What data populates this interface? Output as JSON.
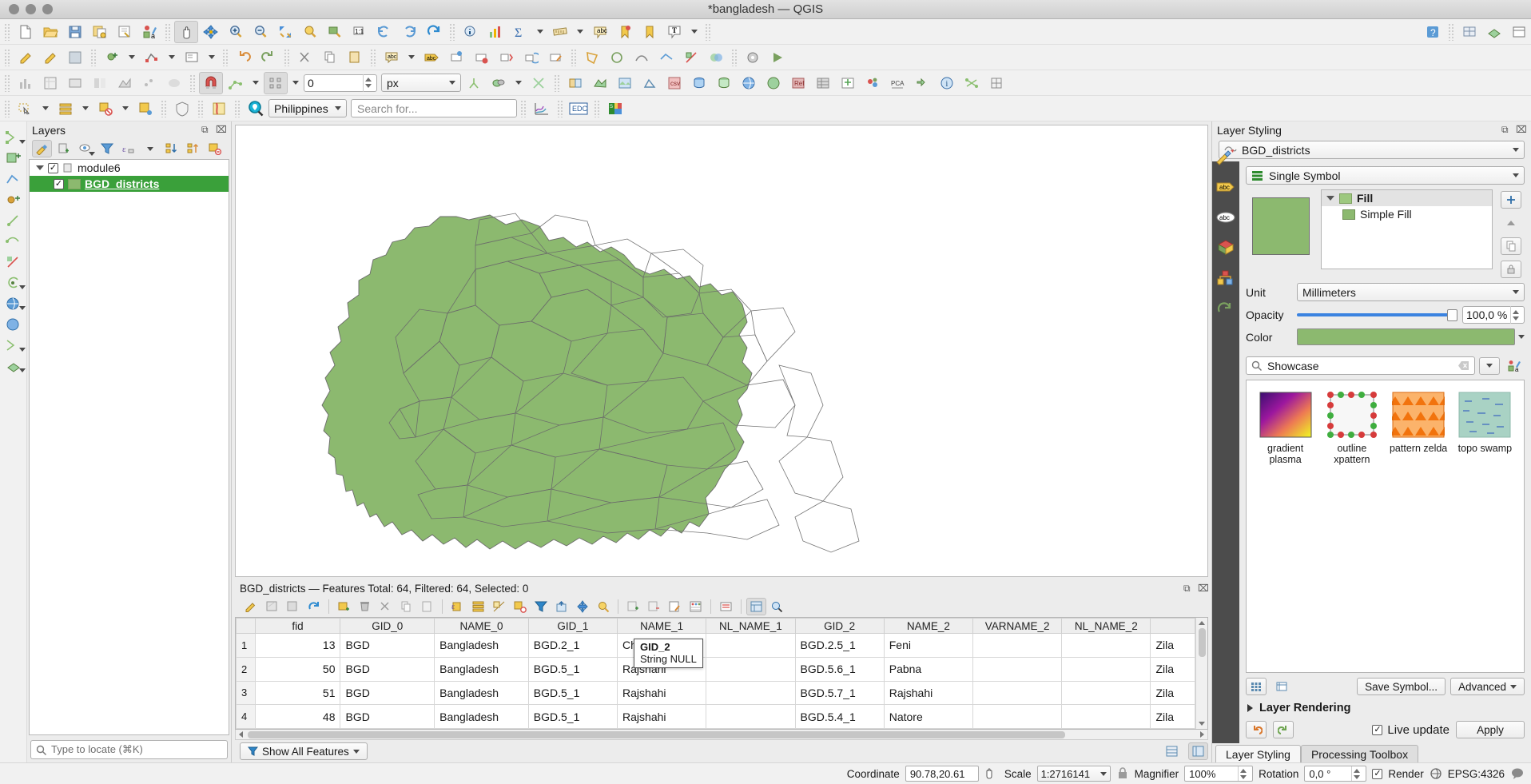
{
  "window": {
    "title": "*bangladesh — QGIS"
  },
  "toolbars": {
    "row1": [
      {
        "name": "new-project-icon",
        "label": "New Project"
      },
      {
        "name": "open-project-icon",
        "label": "Open Project"
      },
      {
        "name": "save-project-icon",
        "label": "Save Project"
      },
      {
        "name": "save-project-as-icon",
        "label": "Save Project As"
      },
      {
        "name": "new-print-layout-icon",
        "label": "New Print Layout"
      },
      {
        "name": "style-manager-icon",
        "label": "Style Manager"
      },
      {
        "name": "pan-map-icon",
        "label": "Pan Map"
      },
      {
        "name": "pan-to-selection-icon",
        "label": "Pan Map to Selection"
      },
      {
        "name": "zoom-in-icon",
        "label": "Zoom In"
      },
      {
        "name": "zoom-out-icon",
        "label": "Zoom Out"
      },
      {
        "name": "zoom-full-icon",
        "label": "Zoom Full"
      },
      {
        "name": "zoom-to-selection-icon",
        "label": "Zoom To Selection"
      },
      {
        "name": "zoom-to-layer-icon",
        "label": "Zoom To Layer"
      },
      {
        "name": "zoom-to-native-icon",
        "label": "Zoom to Native Resolution"
      },
      {
        "name": "zoom-last-icon",
        "label": "Zoom Last"
      },
      {
        "name": "zoom-next-icon",
        "label": "Zoom Next"
      },
      {
        "name": "refresh-icon",
        "label": "Refresh"
      },
      {
        "name": "identify-features-icon",
        "label": "Identify Features"
      },
      {
        "name": "statistical-summary-icon",
        "label": "Statistical Summary"
      },
      {
        "name": "sum-icon",
        "label": "Field Calculator"
      },
      {
        "name": "measure-line-icon",
        "label": "Measure Line"
      },
      {
        "name": "map-tips-icon",
        "label": "Show Map Tips"
      },
      {
        "name": "new-bookmark-icon",
        "label": "New Spatial Bookmark"
      },
      {
        "name": "text-annotation-icon",
        "label": "Text Annotation"
      },
      {
        "name": "python-console-icon",
        "label": "Python Console"
      },
      {
        "name": "help-icon",
        "label": "Help"
      },
      {
        "name": "georeferencer-icon",
        "label": "Georeferencer"
      },
      {
        "name": "3d-map-icon",
        "label": "New 3D Map View"
      },
      {
        "name": "layout-manager-icon",
        "label": "Layout Manager"
      }
    ],
    "row2_units_value": "0",
    "row2_units": "px"
  },
  "search": {
    "region_value": "Philippines",
    "placeholder": "Search for...",
    "edc_label": "EDC"
  },
  "layers_panel": {
    "title": "Layers",
    "toolbar": [
      {
        "name": "open-layer-styling-icon",
        "label": "Open Layer Styling Panel",
        "active": true
      },
      {
        "name": "add-group-icon",
        "label": "Add Group"
      },
      {
        "name": "manage-visibility-icon",
        "label": "Manage Map Themes"
      },
      {
        "name": "filter-legend-icon",
        "label": "Filter Legend By Map Content"
      },
      {
        "name": "expression-filter-icon",
        "label": "Filter Legend By Expression"
      },
      {
        "name": "expand-all-icon",
        "label": "Expand All"
      },
      {
        "name": "collapse-all-icon",
        "label": "Collapse All"
      },
      {
        "name": "remove-layer-icon",
        "label": "Remove Layer/Group"
      }
    ],
    "tree": [
      {
        "name": "group-module6",
        "label": "module6",
        "checked": true,
        "type": "group"
      },
      {
        "name": "layer-bgd-districts",
        "label": "BGD_districts",
        "checked": true,
        "type": "layer",
        "selected": true
      }
    ]
  },
  "locator": {
    "placeholder": "Type to locate (⌘K)"
  },
  "attribute_table": {
    "title": "BGD_districts — Features Total: 64, Filtered: 64, Selected: 0",
    "toolbar": [
      {
        "name": "toggle-editing-icon",
        "label": "Toggle Editing Mode"
      },
      {
        "name": "save-edits-icon",
        "label": "Save Edits"
      },
      {
        "name": "reload-table-icon",
        "label": "Reload The Table"
      },
      {
        "name": "refresh-table-icon",
        "label": "Refresh Table"
      },
      {
        "name": "add-feature-icon",
        "label": "Add Feature"
      },
      {
        "name": "delete-selected-icon",
        "label": "Delete Selected Features"
      },
      {
        "name": "cut-features-icon",
        "label": "Cut Features"
      },
      {
        "name": "copy-features-icon",
        "label": "Copy Features"
      },
      {
        "name": "paste-features-icon",
        "label": "Paste Features"
      },
      {
        "name": "select-by-expression-icon",
        "label": "Select Features By Expression"
      },
      {
        "name": "select-all-icon",
        "label": "Select All Features"
      },
      {
        "name": "invert-selection-icon",
        "label": "Invert Feature Selection"
      },
      {
        "name": "deselect-all-icon",
        "label": "Deselect All Features"
      },
      {
        "name": "filter-select-icon",
        "label": "Filter / Select Features"
      },
      {
        "name": "move-selection-top-icon",
        "label": "Move Selection To Top"
      },
      {
        "name": "pan-to-selected-icon",
        "label": "Pan Map To Selected Rows"
      },
      {
        "name": "zoom-to-selected-icon",
        "label": "Zoom Map To Selected Rows"
      },
      {
        "name": "new-field-icon",
        "label": "New Field"
      },
      {
        "name": "delete-field-icon",
        "label": "Delete Field"
      },
      {
        "name": "open-field-calculator-icon",
        "label": "Open Field Calculator"
      },
      {
        "name": "conditional-formatting-icon",
        "label": "Conditional Formatting"
      },
      {
        "name": "organize-columns-icon",
        "label": "Organize Columns"
      },
      {
        "name": "toggle-form-view-icon",
        "label": "Switch To Form View",
        "active": true
      },
      {
        "name": "dock-table-icon",
        "label": "Dock Attribute Table"
      }
    ],
    "columns": [
      "fid",
      "GID_0",
      "NAME_0",
      "GID_1",
      "NAME_1",
      "NL_NAME_1",
      "GID_2",
      "NAME_2",
      "VARNAME_2",
      "NL_NAME_2",
      ""
    ],
    "rows": [
      {
        "n": "1",
        "fid": "13",
        "GID_0": "BGD",
        "NAME_0": "Bangladesh",
        "GID_1": "BGD.2_1",
        "NAME_1": "Chittagong",
        "NL_NAME_1": "",
        "GID_2": "BGD.2.5_1",
        "NAME_2": "Feni",
        "VARNAME_2": "",
        "NL_NAME_2": "",
        "TYPE_2": "Zila"
      },
      {
        "n": "2",
        "fid": "50",
        "GID_0": "BGD",
        "NAME_0": "Bangladesh",
        "GID_1": "BGD.5_1",
        "NAME_1": "Rajshahi",
        "NL_NAME_1": "",
        "GID_2": "BGD.5.6_1",
        "NAME_2": "Pabna",
        "VARNAME_2": "",
        "NL_NAME_2": "",
        "TYPE_2": "Zila"
      },
      {
        "n": "3",
        "fid": "51",
        "GID_0": "BGD",
        "NAME_0": "Bangladesh",
        "GID_1": "BGD.5_1",
        "NAME_1": "Rajshahi",
        "NL_NAME_1": "",
        "GID_2": "BGD.5.7_1",
        "NAME_2": "Rajshahi",
        "VARNAME_2": "",
        "NL_NAME_2": "",
        "TYPE_2": "Zila"
      },
      {
        "n": "4",
        "fid": "48",
        "GID_0": "BGD",
        "NAME_0": "Bangladesh",
        "GID_1": "BGD.5_1",
        "NAME_1": "Rajshahi",
        "NL_NAME_1": "",
        "GID_2": "BGD.5.4_1",
        "NAME_2": "Natore",
        "VARNAME_2": "",
        "NL_NAME_2": "",
        "TYPE_2": "Zila"
      }
    ],
    "tooltip": {
      "field": "GID_2",
      "type": "String NULL"
    },
    "show_all_features": "Show All Features"
  },
  "layer_styling": {
    "title": "Layer Styling",
    "layer_name": "BGD_districts",
    "renderer": "Single Symbol",
    "side_tabs": [
      {
        "name": "symbology-tab",
        "label": "Symbology"
      },
      {
        "name": "labels-tab",
        "label": "Labels"
      },
      {
        "name": "masks-tab",
        "label": "Masks"
      },
      {
        "name": "3d-view-tab",
        "label": "3D View"
      },
      {
        "name": "diagrams-tab",
        "label": "Diagrams"
      },
      {
        "name": "history-tab",
        "label": "History"
      }
    ],
    "symbol_tree": [
      {
        "name": "symbol-layer-fill",
        "label": "Fill",
        "level": 0
      },
      {
        "name": "symbol-layer-simple-fill",
        "label": "Simple Fill",
        "level": 1
      }
    ],
    "unit_label": "Unit",
    "unit_value": "Millimeters",
    "opacity_label": "Opacity",
    "opacity_value": "100,0 %",
    "color_label": "Color",
    "color_value": "#8cb96f",
    "search_value": "Showcase",
    "gallery": [
      {
        "name": "symbol-gradient-plasma",
        "label": "gradient  plasma",
        "kind": "gradient"
      },
      {
        "name": "symbol-outline-xpattern",
        "label": "outline xpattern",
        "kind": "outline"
      },
      {
        "name": "symbol-pattern-zelda",
        "label": "pattern zelda",
        "kind": "pattern"
      },
      {
        "name": "symbol-topo-swamp",
        "label": "topo swamp",
        "kind": "topo"
      }
    ],
    "save_symbol": "Save Symbol...",
    "advanced": "Advanced",
    "layer_rendering": "Layer Rendering",
    "live_update": "Live update",
    "apply": "Apply",
    "tabs": [
      {
        "name": "tab-layer-styling",
        "label": "Layer Styling",
        "active": true
      },
      {
        "name": "tab-processing-toolbox",
        "label": "Processing Toolbox",
        "active": false
      }
    ]
  },
  "status_bar": {
    "coordinate_label": "Coordinate",
    "coordinate_value": "90.78,20.61",
    "scale_label": "Scale",
    "scale_value": "1:2716141",
    "magnifier_label": "Magnifier",
    "magnifier_value": "100%",
    "rotation_label": "Rotation",
    "rotation_value": "0,0 °",
    "render_label": "Render",
    "crs_label": "EPSG:4326"
  }
}
